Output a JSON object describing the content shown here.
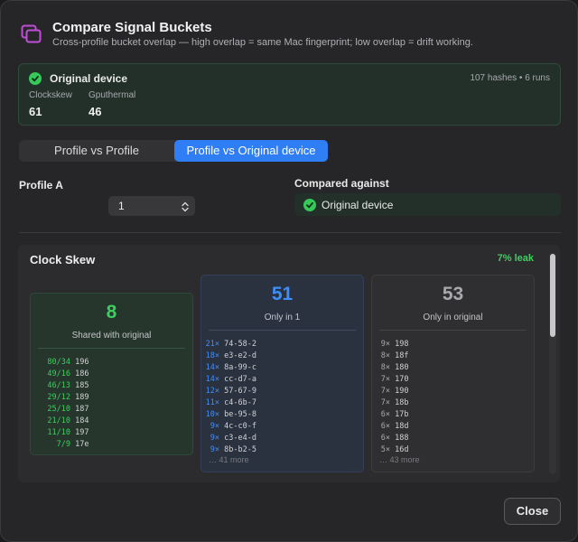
{
  "header": {
    "title": "Compare Signal Buckets",
    "subtitle": "Cross-profile bucket overlap — high overlap = same Mac fingerprint; low overlap = drift working.",
    "icon": "overlapping-windows-icon",
    "accent": "#c04ed8"
  },
  "device_card": {
    "name": "Original device",
    "meta": "107 hashes • 6 runs",
    "stats": [
      {
        "label": "Clockskew",
        "value": "61"
      },
      {
        "label": "Gputhermal",
        "value": "46"
      }
    ]
  },
  "segmented": {
    "options": [
      "Profile vs Profile",
      "Profile vs Original device"
    ],
    "selected": 1
  },
  "profile_a": {
    "label": "Profile A",
    "value": "1"
  },
  "compared": {
    "label": "Compared against",
    "value": "Original device"
  },
  "panel": {
    "title": "Clock Skew",
    "leak": "7% leak",
    "buckets": {
      "shared": {
        "count": "8",
        "caption": "Shared with original",
        "rows": [
          {
            "k": "80/34",
            "v": "196"
          },
          {
            "k": "49/16",
            "v": "186"
          },
          {
            "k": "46/13",
            "v": "185"
          },
          {
            "k": "29/12",
            "v": "189"
          },
          {
            "k": "25/10",
            "v": "187"
          },
          {
            "k": "21/10",
            "v": "184"
          },
          {
            "k": "11/10",
            "v": "197"
          },
          {
            "k": "7/9",
            "v": "17e"
          }
        ]
      },
      "only1": {
        "count": "51",
        "caption": "Only in 1",
        "rows": [
          {
            "k": "21×",
            "v": "74-58-2"
          },
          {
            "k": "18×",
            "v": "e3-e2-d"
          },
          {
            "k": "14×",
            "v": "8a-99-c"
          },
          {
            "k": "14×",
            "v": "cc-d7-a"
          },
          {
            "k": "12×",
            "v": "57-67-9"
          },
          {
            "k": "11×",
            "v": "c4-6b-7"
          },
          {
            "k": "10×",
            "v": "be-95-8"
          },
          {
            "k": "9×",
            "v": "4c-c0-f"
          },
          {
            "k": "9×",
            "v": "c3-e4-d"
          },
          {
            "k": "9×",
            "v": "8b-b2-5"
          }
        ],
        "more": "… 41 more"
      },
      "only_orig": {
        "count": "53",
        "caption": "Only in original",
        "rows": [
          {
            "k": "9×",
            "v": "198"
          },
          {
            "k": "8×",
            "v": "18f"
          },
          {
            "k": "8×",
            "v": "180"
          },
          {
            "k": "7×",
            "v": "170"
          },
          {
            "k": "7×",
            "v": "190"
          },
          {
            "k": "7×",
            "v": "18b"
          },
          {
            "k": "6×",
            "v": "17b"
          },
          {
            "k": "6×",
            "v": "18d"
          },
          {
            "k": "6×",
            "v": "188"
          },
          {
            "k": "5×",
            "v": "16d"
          }
        ],
        "more": "… 43 more"
      }
    }
  },
  "footer": {
    "close_label": "Close"
  }
}
